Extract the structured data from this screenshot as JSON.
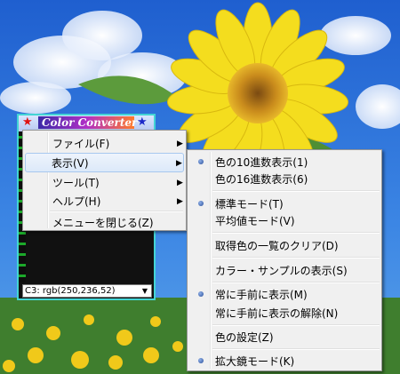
{
  "colors": {
    "sky": "#2d6fd6",
    "cloud": "#f2f6ff",
    "petal": "#f4dd1e",
    "menu_bg": "#f0f0f0",
    "window_frame": "#43d4d4"
  },
  "app": {
    "title": "Color Converter",
    "color_value": "C3: rgb(250,236,52)"
  },
  "main_menu": {
    "items": [
      {
        "label": "ファイル(F)",
        "submenu": true
      },
      {
        "label": "表示(V)",
        "submenu": true,
        "highlighted": true
      },
      {
        "label": "ツール(T)",
        "submenu": true
      },
      {
        "label": "ヘルプ(H)",
        "submenu": true
      },
      {
        "label": "メニューを閉じる(Z)",
        "submenu": false
      }
    ]
  },
  "view_menu": {
    "items": [
      {
        "label": "色の10進数表示(1)",
        "checked": true
      },
      {
        "label": "色の16進数表示(6)",
        "checked": false
      },
      {
        "label": "標準モード(T)",
        "checked": true
      },
      {
        "label": "平均値モード(V)",
        "checked": false
      },
      {
        "label": "取得色の一覧のクリア(D)",
        "checked": false
      },
      {
        "label": "カラー・サンプルの表示(S)",
        "checked": false
      },
      {
        "label": "常に手前に表示(M)",
        "checked": true
      },
      {
        "label": "常に手前に表示の解除(N)",
        "checked": false
      },
      {
        "label": "色の設定(Z)",
        "checked": false
      },
      {
        "label": "拡大鏡モード(K)",
        "checked": true
      }
    ]
  }
}
